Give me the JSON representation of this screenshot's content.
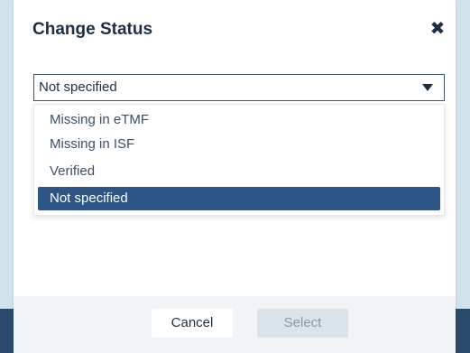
{
  "dialog": {
    "title": "Change Status",
    "close_icon": "close-icon"
  },
  "select": {
    "value": "Not specified",
    "arrow_icon": "caret-down-icon"
  },
  "options": [
    {
      "label": "Missing in eTMF",
      "selected": false
    },
    {
      "label": "Missing in ISF",
      "selected": false
    },
    {
      "label": "Verified",
      "selected": false
    },
    {
      "label": "Not specified",
      "selected": true
    }
  ],
  "footer": {
    "cancel_label": "Cancel",
    "select_label": "Select",
    "select_enabled": false
  },
  "colors": {
    "highlight": "#2d5586",
    "title_text": "#1d2f45",
    "footer_bg": "#f0f4f6",
    "backdrop": "#d3e3ee"
  }
}
